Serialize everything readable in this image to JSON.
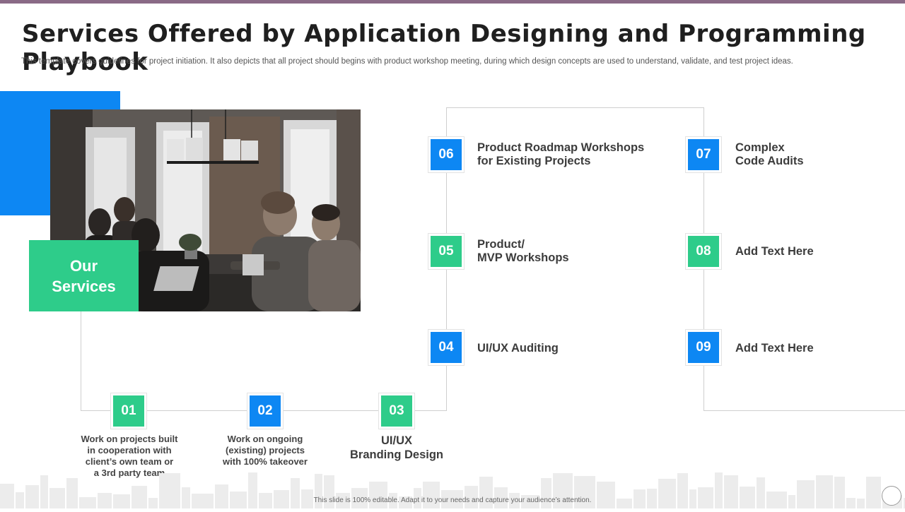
{
  "slide": {
    "title": "Services Offered by Application Designing and Programming Playbook",
    "subtitle": "This template covers guidelines for project initiation. It also depicts that all project should begins with product workshop meeting, during which design concepts are used to understand, validate, and test project ideas.",
    "panel_label": "Our\nServices",
    "footer": "This slide is 100% editable. Adapt it to your needs and capture your audience’s attention."
  },
  "colors": {
    "green": "#2ecc8a",
    "blue": "#0d87f3",
    "top_bar": "#8a6a86"
  },
  "photo": {
    "icon": "team-meeting-photo"
  },
  "services": [
    {
      "number": "01",
      "label": "Work on projects  built\nin  cooperation  with\nclient’s  own  team  or\na  3rd party team",
      "color": "green"
    },
    {
      "number": "02",
      "label": "Work on ongoing\n(existing)  projects\nwith 100%  takeover",
      "color": "blue"
    },
    {
      "number": "03",
      "label": "UI/UX\nBranding Design",
      "color": "green"
    },
    {
      "number": "04",
      "label": "UI/UX Auditing",
      "color": "blue"
    },
    {
      "number": "05",
      "label": "Product/\nMVP Workshops",
      "color": "green"
    },
    {
      "number": "06",
      "label": "Product Roadmap Workshops\nfor Existing Projects",
      "color": "blue"
    },
    {
      "number": "07",
      "label": "Complex\nCode Audits",
      "color": "blue"
    },
    {
      "number": "08",
      "label": "Add  Text Here",
      "color": "green"
    },
    {
      "number": "09",
      "label": "Add  Text Here",
      "color": "blue"
    }
  ]
}
